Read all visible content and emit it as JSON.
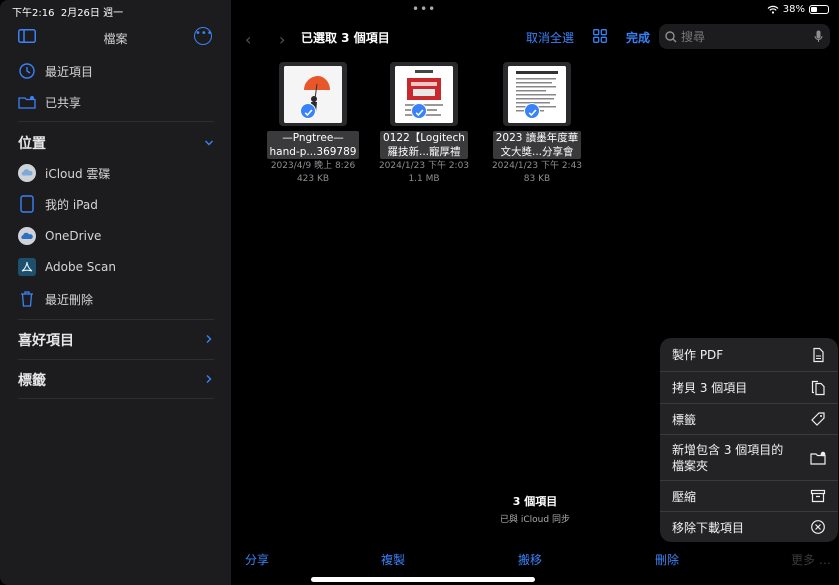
{
  "status": {
    "time": "下午2:16",
    "date": "2月26日 週一",
    "dots": "•••",
    "battery": "38%"
  },
  "sidebar": {
    "title": "檔案",
    "recents": [
      {
        "label": "最近項目",
        "icon": "clock-icon"
      },
      {
        "label": "已共享",
        "icon": "shared-folder-icon"
      }
    ],
    "locations_header": "位置",
    "locations": [
      {
        "label": "iCloud 雲碟",
        "icon": "icloud-icon"
      },
      {
        "label": "我的 iPad",
        "icon": "ipad-icon"
      },
      {
        "label": "OneDrive",
        "icon": "onedrive-icon"
      },
      {
        "label": "Adobe Scan",
        "icon": "adobe-scan-icon"
      },
      {
        "label": "最近刪除",
        "icon": "trash-icon"
      }
    ],
    "favorites_header": "喜好項目",
    "tags_header": "標籤"
  },
  "toolbar": {
    "selected_title": "已選取 3 個項目",
    "deselect_all": "取消全選",
    "done": "完成",
    "search_placeholder": "搜尋"
  },
  "files": [
    {
      "name_line1": "—Pngtree—",
      "name_line2": "hand-p...369789",
      "date": "2023/4/9 晚上 8:26",
      "size": "423 KB",
      "selected": true
    },
    {
      "name_line1": "0122【Logitech",
      "name_line2": "羅技新...寵厚禮",
      "date": "2024/1/23 下午 2:03",
      "size": "1.1 MB",
      "selected": true
    },
    {
      "name_line1": "2023 讀墨年度華",
      "name_line2": "文大獎...分享會",
      "date": "2024/1/23 下午 2:43",
      "size": "83 KB",
      "selected": true
    }
  ],
  "footer": {
    "count": "3 個項目",
    "sync": "已與 iCloud 同步"
  },
  "bottom_bar": {
    "share": "分享",
    "copy": "複製",
    "move": "搬移",
    "delete": "刪除",
    "more": "更多"
  },
  "menu": [
    {
      "label": "製作 PDF",
      "icon": "pdf-doc-icon"
    },
    {
      "label": "拷貝 3 個項目",
      "icon": "copy-docs-icon"
    },
    {
      "label": "標籤",
      "icon": "tag-icon"
    },
    {
      "label": "新增包含 3 個項目的",
      "label2": "檔案夾",
      "icon": "new-folder-icon"
    },
    {
      "label": "壓縮",
      "icon": "archive-box-icon"
    },
    {
      "label": "移除下載項目",
      "icon": "remove-download-icon"
    }
  ],
  "colors": {
    "accent": "#3a82f7",
    "sidebar_bg": "#1c1c1e",
    "menu_bg": "#232325"
  }
}
